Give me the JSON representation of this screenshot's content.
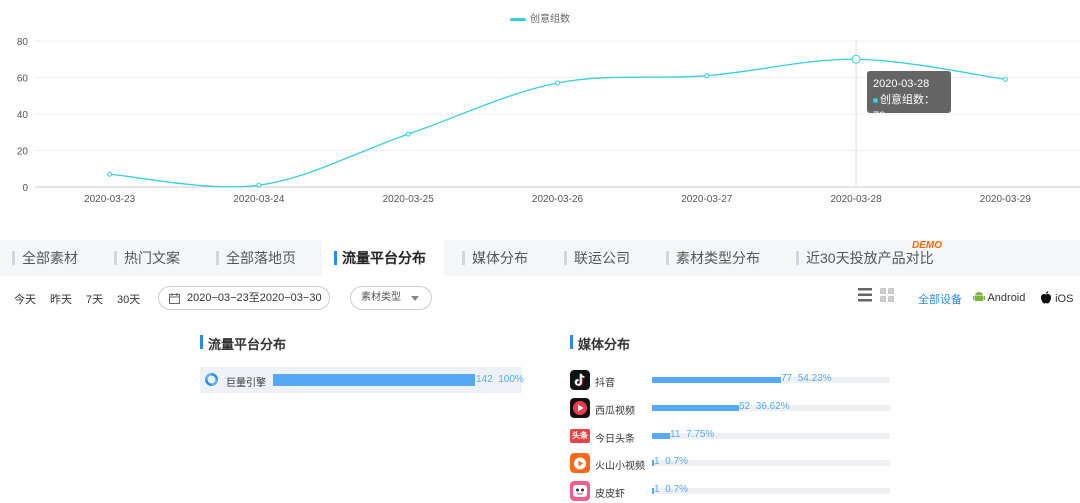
{
  "chart_data": {
    "type": "line",
    "legend": [
      "创意组数"
    ],
    "series": [
      {
        "name": "创意组数",
        "values": [
          7,
          1,
          29,
          57,
          61,
          70,
          59
        ]
      }
    ],
    "categories": [
      "2020-03-23",
      "2020-03-24",
      "2020-03-25",
      "2020-03-26",
      "2020-03-27",
      "2020-03-28",
      "2020-03-29"
    ],
    "yticks": [
      0,
      20,
      40,
      60,
      80
    ],
    "ylim": [
      0,
      80
    ],
    "grid": true,
    "color": "#36cfdc",
    "tooltip": {
      "date": "2020-03-28",
      "series": "创意组数",
      "value": "70",
      "text": "创意组数：70"
    }
  },
  "tabs": [
    {
      "label": "全部素材"
    },
    {
      "label": "热门文案"
    },
    {
      "label": "全部落地页"
    },
    {
      "label": "流量平台分布"
    },
    {
      "label": "媒体分布"
    },
    {
      "label": "联运公司"
    },
    {
      "label": "素材类型分布"
    },
    {
      "label": "近30天投放产品对比"
    }
  ],
  "demo_badge": "DEMO",
  "filters": {
    "quick": [
      "今天",
      "昨天",
      "7天",
      "30天"
    ],
    "date_range": "2020−03−23至2020−03−30",
    "select_value": "素材类型"
  },
  "devices": {
    "all": "全部设备",
    "android": "Android",
    "ios": "iOS"
  },
  "flow_panel": {
    "title": "流量平台分布",
    "rows": [
      {
        "name": "巨量引擎",
        "count": "142",
        "percent": "100%",
        "fraction": 1.0
      }
    ]
  },
  "media_panel": {
    "title": "媒体分布",
    "rows": [
      {
        "name": "抖音",
        "count": "77",
        "percent": "54.23%",
        "fraction": 0.5423
      },
      {
        "name": "西瓜视频",
        "count": "52",
        "percent": "36.62%",
        "fraction": 0.3662
      },
      {
        "name": "今日头条",
        "count": "11",
        "percent": "7.75%",
        "fraction": 0.0775,
        "logo_text": "头条"
      },
      {
        "name": "火山小视频",
        "count": "1",
        "percent": "0.7%",
        "fraction": 0.007
      },
      {
        "name": "皮皮虾",
        "count": "1",
        "percent": "0.7%",
        "fraction": 0.007
      }
    ]
  },
  "colors": {
    "accent": "#2a8cea",
    "bar": "#56a9f4",
    "line": "#36cfdc",
    "demo": "#ff6a00"
  }
}
